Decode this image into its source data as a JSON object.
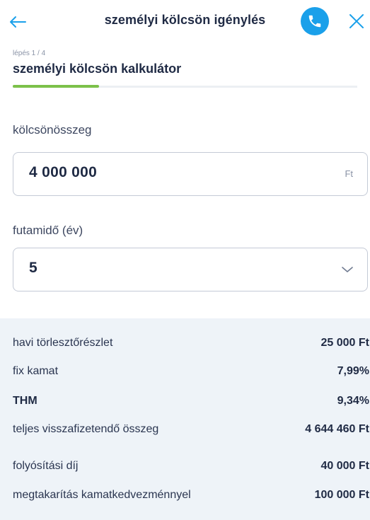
{
  "header": {
    "title": "személyi kölcsön igénylés",
    "back_icon": "arrow-left-icon",
    "phone_icon": "phone-icon",
    "close_icon": "close-icon",
    "accent_color": "#1aa0ea"
  },
  "step": {
    "label": "lépés 1 / 4",
    "title": "személyi kölcsön kalkulátor",
    "progress": 0.25,
    "progress_color": "#7cc14a"
  },
  "amount": {
    "label": "kölcsönösszeg",
    "value": "4 000 000",
    "unit": "Ft"
  },
  "term": {
    "label": "futamidő (év)",
    "value": "5",
    "icon": "chevron-down-icon"
  },
  "summary": {
    "rows": [
      {
        "label": "havi törlesztőrészlet",
        "value": "25 000 Ft"
      },
      {
        "label": "fix kamat",
        "value": "7,99%"
      },
      {
        "label": "THM",
        "value": "9,34%"
      },
      {
        "label": "teljes visszafizetendő összeg",
        "value": "4 644 460 Ft"
      },
      {
        "label": "folyósítási díj",
        "value": "40 000 Ft"
      },
      {
        "label": "megtakarítás kamatkedvezménnyel",
        "value": "100 000 Ft"
      }
    ]
  }
}
